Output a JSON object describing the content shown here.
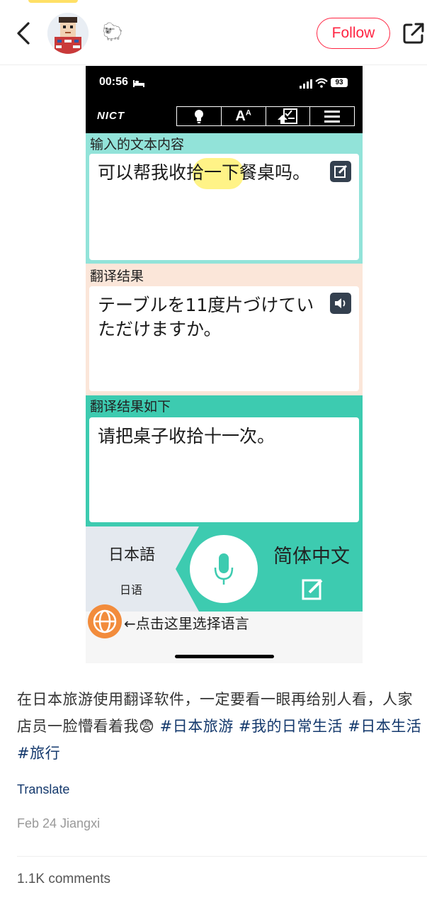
{
  "header": {
    "follow_label": "Follow",
    "badge_emoji": "🐑"
  },
  "screenshot": {
    "status_time": "00:56",
    "battery": "93",
    "logo": "NICT",
    "input_label": "输入的文本内容",
    "input_text": "可以帮我收拾一下餐桌吗。",
    "result_label": "翻译结果",
    "result_text": "テーブルを11度片づけていただけますか。",
    "back_label": "翻译结果如下",
    "back_text": "请把桌子收拾十一次。",
    "source_lang": "日本語",
    "source_lang_sub": "日语",
    "target_lang": "简体中文",
    "hint": "←点击这里选择语言",
    "colors": {
      "input_bg": "#92e3d9",
      "result_bg": "#fbe6d9",
      "back_bg": "#3dcbb0",
      "highlight": "#fff27a"
    }
  },
  "post": {
    "caption_text": "在日本旅游使用翻译软件，一定要看一眼再给别人看，人家店员一脸懵看着我",
    "emoji": "😨",
    "tags": [
      "#日本旅游",
      "#我的日常生活",
      "#日本生活",
      "#旅行"
    ],
    "translate_label": "Translate",
    "meta": "Feb 24 Jiangxi",
    "comments": "1.1K comments"
  },
  "colors": {
    "accent": "#ff2442",
    "link": "#13386c"
  }
}
